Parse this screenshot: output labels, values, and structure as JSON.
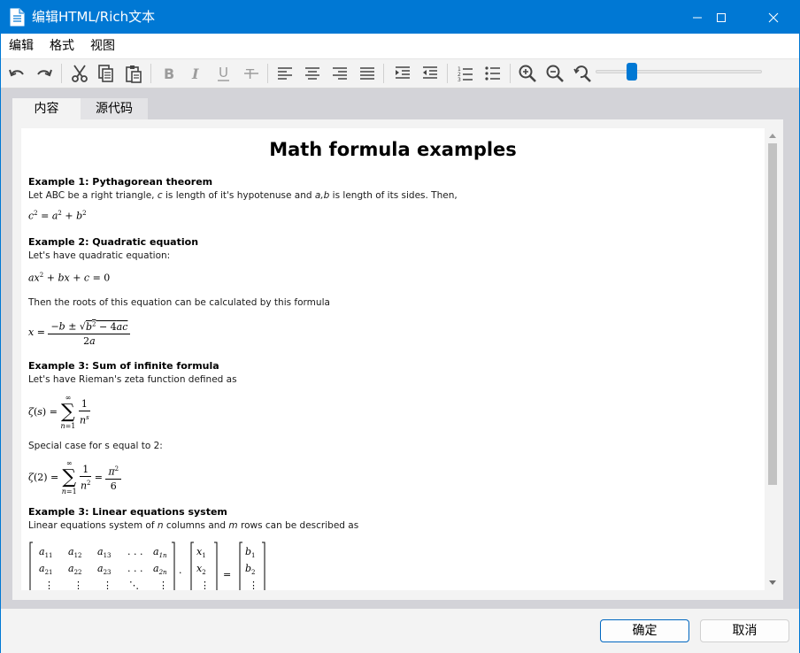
{
  "window": {
    "title": "编辑HTML/Rich文本",
    "accent": "#0078d4"
  },
  "menu": [
    "编辑",
    "格式",
    "视图"
  ],
  "toolbar": {
    "icons": [
      "undo-icon",
      "redo-icon",
      "cut-icon",
      "copy-icon",
      "paste-icon",
      "bold-icon",
      "italic-icon",
      "underline-icon",
      "strikethrough-icon",
      "align-left-icon",
      "align-center-icon",
      "align-right-icon",
      "align-justify-icon",
      "indent-icon",
      "outdent-icon",
      "numbered-list-icon",
      "bullet-list-icon",
      "zoom-in-icon",
      "zoom-out-icon",
      "zoom-reset-icon"
    ],
    "zoom_level": 0.2
  },
  "tabs": [
    {
      "label": "内容",
      "active": true
    },
    {
      "label": "源代码",
      "active": false
    }
  ],
  "doc": {
    "title": "Math formula examples",
    "ex1": {
      "heading": "Example 1: Pythagorean theorem",
      "text_a": "Let ABC be a right triangle, ",
      "text_c": "c",
      "text_b": " is length of it's hypotenuse and ",
      "text_ab": "a,b",
      "text_d": " is length of its sides. Then,"
    },
    "ex2": {
      "heading": "Example 2: Quadratic equation",
      "text1": "Let's have quadratic equation:",
      "text2": "Then the roots of this equation can be calculated by this formula"
    },
    "ex3": {
      "heading": "Example 3: Sum of infinite formula",
      "text1": "Let's have Rieman's zeta function defined as",
      "text2": "Special case for s equal to 2:"
    },
    "ex4": {
      "heading": "Example 3: Linear equations system",
      "text_a": "Linear equations system of ",
      "text_n": "n",
      "text_b": " columns and ",
      "text_m": "m",
      "text_c": " rows can be described as"
    }
  },
  "buttons": {
    "ok": "确定",
    "cancel": "取消"
  }
}
